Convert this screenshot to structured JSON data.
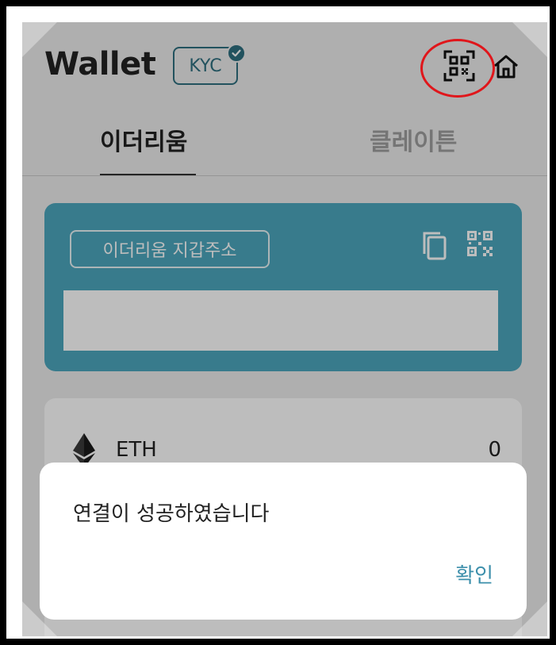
{
  "header": {
    "title": "Wallet",
    "kyc_badge": "KYC",
    "qr_scan_icon": "qr-scan-icon",
    "home_icon": "home-icon"
  },
  "tabs": [
    {
      "label": "이더리움",
      "active": true
    },
    {
      "label": "클레이튼",
      "active": false
    }
  ],
  "address_card": {
    "label": "이더리움 지갑주소",
    "address": "",
    "copy_icon": "copy-icon",
    "qr_icon": "qr-code-icon"
  },
  "tokens": [
    {
      "symbol": "ETH",
      "balance": "0",
      "icon": "ethereum-icon"
    }
  ],
  "dialog": {
    "message": "연결이 성공하였습니다",
    "confirm_label": "확인"
  },
  "colors": {
    "accent": "#2e6f7f",
    "card": "#4ca7bd",
    "confirm_text": "#3c8fab",
    "annotation_circle": "#e0161b"
  }
}
